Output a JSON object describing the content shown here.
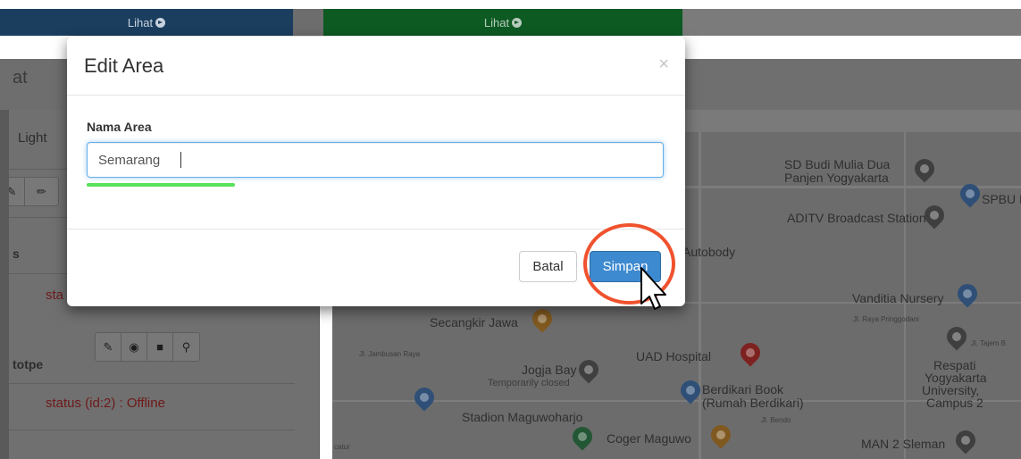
{
  "background": {
    "top_buttons": [
      {
        "label": "Lihat"
      },
      {
        "label": "Lihat"
      }
    ],
    "header_label": "at",
    "left_panel": {
      "light_label": "Light",
      "section_label": "s",
      "status_partial": "sta",
      "device_name": "totpe",
      "device_status": "status (id:2) : Offline"
    },
    "map_labels": {
      "sd_budi": "SD Budi Mulia Dua",
      "panjen": "Panjen Yogyakarta",
      "spbu": "SPBU P",
      "aditv": "ADITV Broadcast Station",
      "autobody": "di Autobody",
      "vanditia": "Vanditia Nursery",
      "raya_pringgodani": "Jl. Raya Pringgodani",
      "secangkir": "Secangkir Jawa",
      "uad": "UAD Hospital",
      "jogja_bay": "Jogja Bay",
      "temp_closed": "Temporarily closed",
      "berdikari1": "Berdikari Book",
      "berdikari2": "(Rumah Berdikari)",
      "stadion": "Stadion Maguwoharjo",
      "coger": "Coger Maguwo",
      "respati1": "Respati",
      "respati2": "Yogyakarta",
      "respati3": "University,",
      "respati4": "Campus 2",
      "man2": "MAN 2 Sleman",
      "tajem": "Jl. Tajem B",
      "jambusan": "Jl. Jambusan Raya",
      "bendo": "Jl. Bendo",
      "catur": "catur"
    },
    "colors": {
      "overlay": "#6f6f6f",
      "blue_button": "#1b3e5f",
      "green_button": "#0d5a23"
    }
  },
  "modal": {
    "title": "Edit Area",
    "close_symbol": "×",
    "field_label": "Nama Area",
    "field_value": "Semarang",
    "cancel_label": "Batal",
    "save_label": "Simpan"
  },
  "annotations": {
    "highlight_color": "#f0522e",
    "underline_color": "#59e05c"
  }
}
